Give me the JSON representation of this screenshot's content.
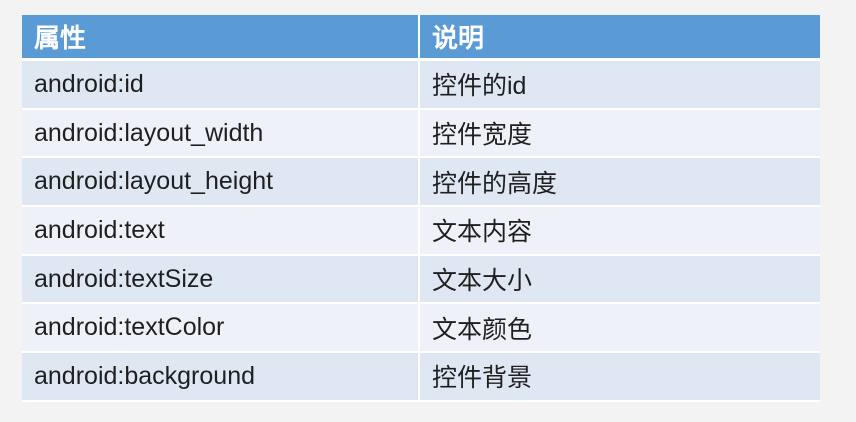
{
  "table": {
    "headers": [
      "属性",
      "说明"
    ],
    "rows": [
      {
        "attribute": "android:id",
        "description": "控件的id"
      },
      {
        "attribute": "android:layout_width",
        "description": "控件宽度"
      },
      {
        "attribute": "android:layout_height",
        "description": "控件的高度"
      },
      {
        "attribute": "android:text",
        "description": "文本内容"
      },
      {
        "attribute": "android:textSize",
        "description": "文本大小"
      },
      {
        "attribute": "android:textColor",
        "description": "文本颜色"
      },
      {
        "attribute": "android:background",
        "description": "控件背景"
      }
    ]
  },
  "colors": {
    "header_bg": "#5b9bd5",
    "row_odd_bg": "#dfe7f2",
    "row_even_bg": "#eef2f8",
    "page_bg": "#f3f3f3"
  }
}
